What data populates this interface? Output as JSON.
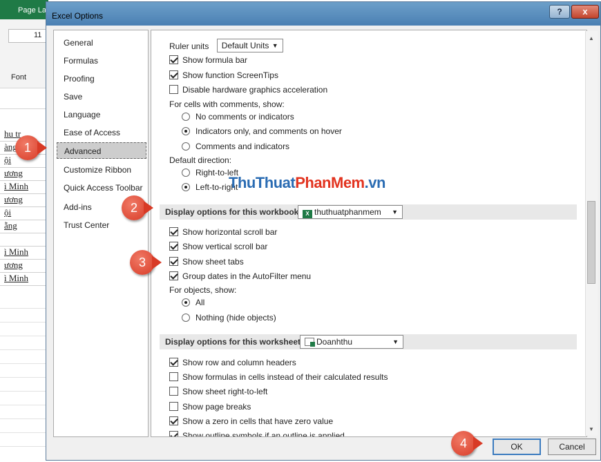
{
  "background": {
    "title_strip": "Page La",
    "font_size": "11",
    "font_group_label": "Font",
    "cells": [
      "hu tr",
      "àng",
      "ội",
      "ương",
      "ì Minh",
      "ương",
      "ội",
      "ẵng",
      "",
      "ì Minh",
      "ương",
      "ì Minh"
    ]
  },
  "dialog": {
    "title": "Excel Options",
    "help": "?",
    "close": "x",
    "ok": "OK",
    "cancel": "Cancel"
  },
  "nav": {
    "items": [
      "General",
      "Formulas",
      "Proofing",
      "Save",
      "Language",
      "Ease of Access",
      "Advanced",
      "Customize Ribbon",
      "Quick Access Toolbar",
      "Add-ins",
      "Trust Center"
    ],
    "selected": "Advanced"
  },
  "content": {
    "ruler_units_label": "Ruler units",
    "ruler_units_value": "Default Units",
    "show_formula_bar": "Show formula bar",
    "show_function_screentips": "Show function ScreenTips",
    "disable_hw_accel": "Disable hardware graphics acceleration",
    "comments_heading": "For cells with comments, show:",
    "comments_none": "No comments or indicators",
    "comments_indicators": "Indicators only, and comments on hover",
    "comments_both": "Comments and indicators",
    "direction_heading": "Default direction:",
    "direction_rtl": "Right-to-left",
    "direction_ltr": "Left-to-right",
    "workbook_section": "Display options for this workbook:",
    "workbook_name": "thuthuatphanmem",
    "show_hscroll": "Show horizontal scroll bar",
    "show_vscroll": "Show vertical scroll bar",
    "show_sheet_tabs": "Show sheet tabs",
    "group_dates": "Group dates in the AutoFilter menu",
    "objects_heading": "For objects, show:",
    "objects_all": "All",
    "objects_nothing": "Nothing (hide objects)",
    "worksheet_section": "Display options for this worksheet:",
    "worksheet_name": "Doanhthu",
    "show_headers": "Show row and column headers",
    "show_formulas": "Show formulas in cells instead of their calculated results",
    "show_rtl": "Show sheet right-to-left",
    "show_page_breaks": "Show page breaks",
    "show_zero": "Show a zero in cells that have zero value",
    "show_outline": "Show outline symbols if an outline is applied"
  },
  "callouts": [
    "1",
    "2",
    "3",
    "4"
  ],
  "watermark": {
    "part1": "ThuThuat",
    "part2": "PhanMem",
    "part3": ".vn"
  },
  "colors": {
    "accent": "#3b7bbf",
    "callout": "#d83a26",
    "watermark_blue": "#2b6cb3",
    "watermark_red": "#e2331f"
  }
}
